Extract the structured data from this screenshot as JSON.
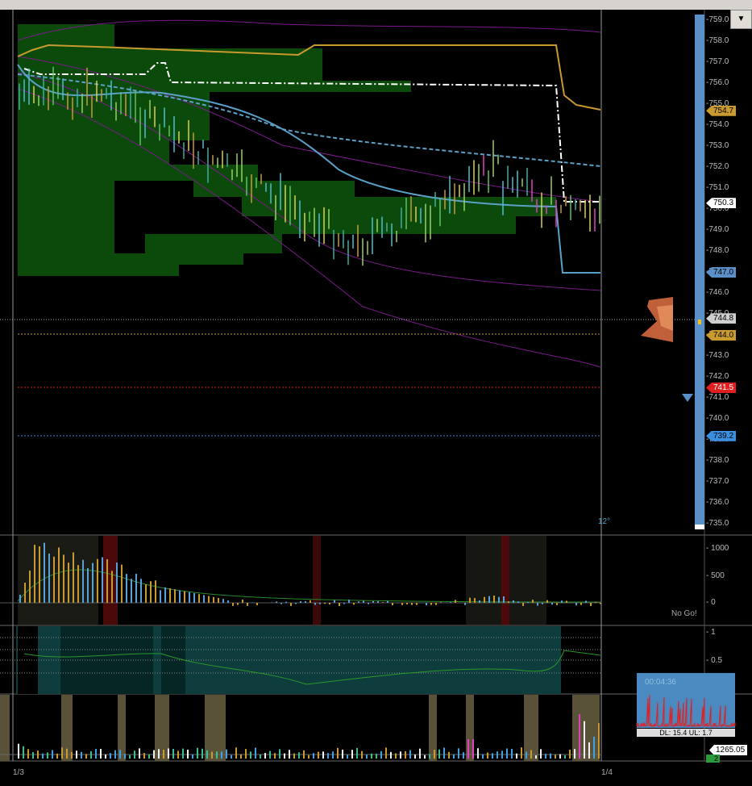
{
  "window": {
    "dropdown_glyph": "▼"
  },
  "price_axis": {
    "ticks": [
      "759.0",
      "758.0",
      "757.0",
      "756.0",
      "755.0",
      "754.0",
      "753.0",
      "752.0",
      "751.0",
      "750.0",
      "749.0",
      "748.0",
      "747.0",
      "746.0",
      "745.0",
      "744.0",
      "743.0",
      "742.0",
      "741.0",
      "740.0",
      "739.0",
      "738.0",
      "737.0",
      "736.0",
      "735.0"
    ],
    "markers": [
      {
        "value": "754.7",
        "color": "#c99a2e"
      },
      {
        "value": "750.3",
        "color": "#ffffff"
      },
      {
        "value": "747.0",
        "color": "#5b8fc7"
      },
      {
        "value": "744.8",
        "color": "#cfcfcf"
      },
      {
        "value": "744.0",
        "color": "#c99a2e"
      },
      {
        "value": "741.5",
        "color": "#e02020"
      },
      {
        "value": "739.2",
        "color": "#3a8fe0"
      }
    ]
  },
  "angle_label": "12°",
  "oscillator_axis": {
    "ticks": [
      "1000",
      "500",
      "0"
    ],
    "status": "No Go!"
  },
  "ratio_axis": {
    "ticks": [
      "1",
      "0.5"
    ]
  },
  "volume_panel": {
    "timer": "00:04:36",
    "stats": "DL: 15.4 UL: 1.7",
    "volume_value": "1265.05",
    "count_badge": "2"
  },
  "time_axis": {
    "labels": [
      "1/3",
      "1/4"
    ]
  },
  "colors": {
    "profile": "#0b4a0b",
    "gold": "#c99a2e",
    "blue": "#5aa0c8",
    "purple": "#7a1a8a",
    "scrollbar": "#5b8fc7"
  }
}
